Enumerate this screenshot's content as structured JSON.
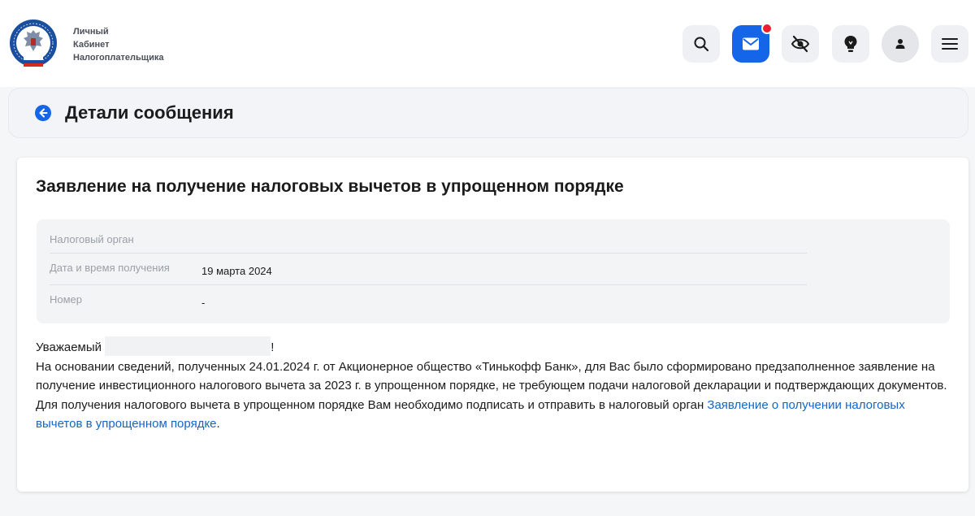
{
  "header": {
    "brand_lines": [
      "Личный",
      "Кабинет",
      "Налогоплательщика"
    ],
    "buttons": [
      {
        "name": "search",
        "icon": "search-icon"
      },
      {
        "name": "messages",
        "icon": "envelope-icon",
        "has_badge": true
      },
      {
        "name": "visually-impaired",
        "icon": "eye-crossed-icon"
      },
      {
        "name": "hints",
        "icon": "lightbulb-icon"
      },
      {
        "name": "profile",
        "icon": "user-icon"
      },
      {
        "name": "menu",
        "icon": "hamburger-icon"
      }
    ],
    "colors": {
      "primary": "#1565e9",
      "badge": "#ee1e2d"
    }
  },
  "page": {
    "title": "Детали сообщения"
  },
  "message": {
    "title": "Заявление на получение налоговых вычетов в упрощенном порядке",
    "details": [
      {
        "label": "Налоговый орган",
        "value": ""
      },
      {
        "label": "Дата и время получения",
        "value": "19 марта 2024"
      },
      {
        "label": "Номер",
        "value": "-"
      }
    ],
    "greeting_prefix": "Уважаемый",
    "greeting_suffix": "!",
    "paragraph1": "На основании сведений, полученных 24.01.2024 г. от Акционерное общество «Тинькофф Банк», для Вас было сформировано предзаполненное заявление на получение инвестиционного налогового вычета за 2023 г. в упрощенном порядке, не требующем подачи налоговой декларации и подтверждающих документов.",
    "paragraph2_prefix": "Для получения налогового вычета в упрощенном порядке Вам необходимо подписать и отправить в налоговый орган ",
    "paragraph2_link": "Заявление о получении налоговых вычетов в упрощенном порядке",
    "paragraph2_suffix": "."
  }
}
